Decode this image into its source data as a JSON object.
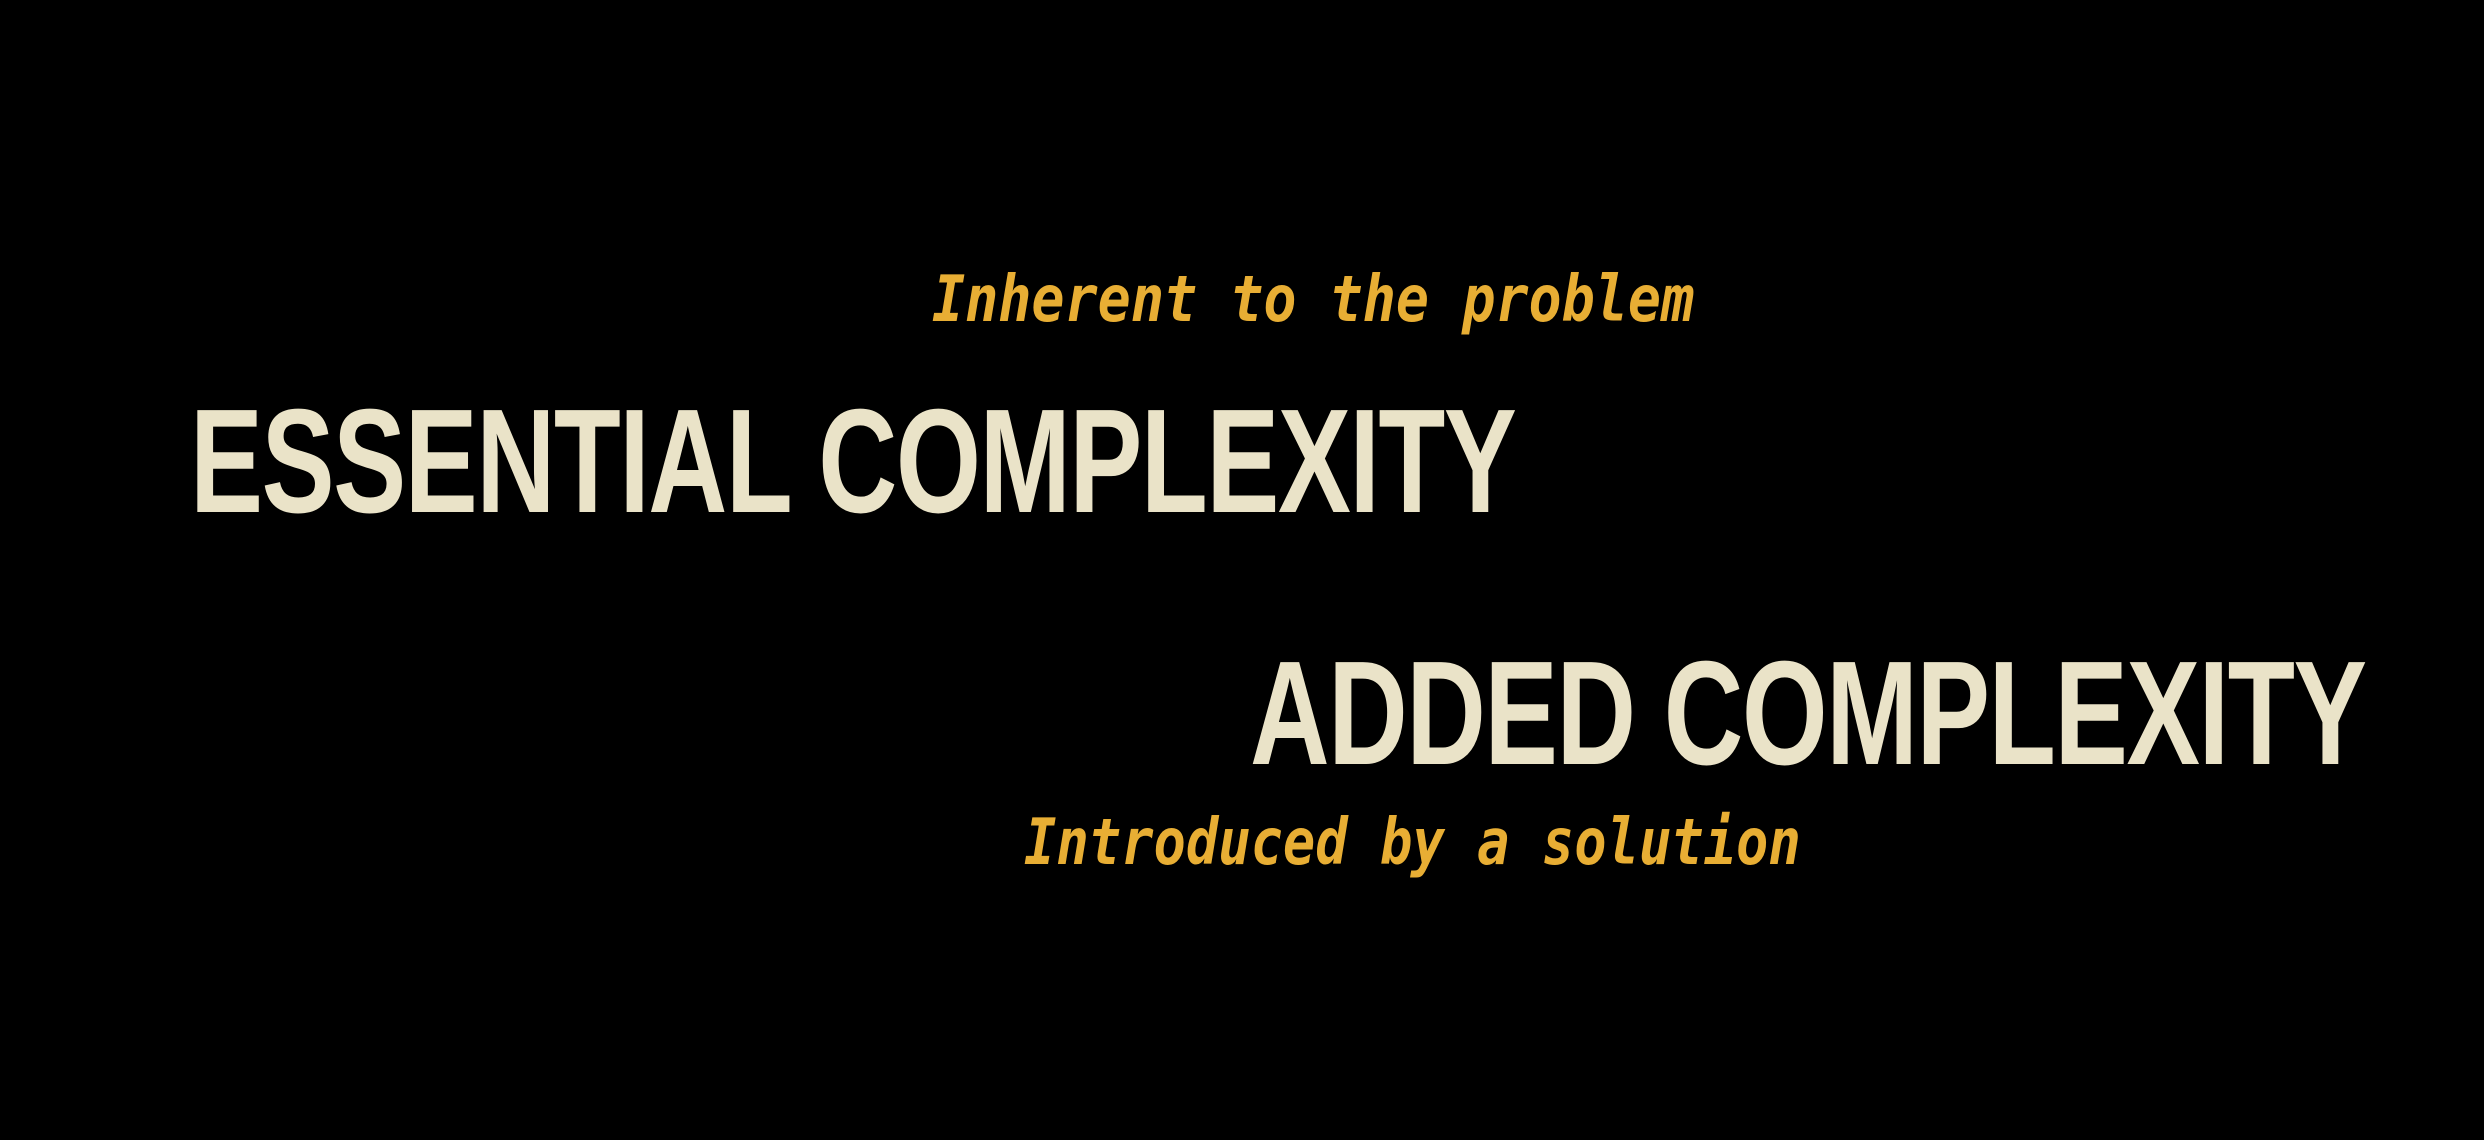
{
  "slide": {
    "background_color": "#000000",
    "text_color": "#EAE3C8",
    "annotation_color": "#E8AE34",
    "essential": {
      "annotation": "Inherent to the problem",
      "title": "ESSENTIAL COMPLEXITY"
    },
    "added": {
      "title": "ADDED COMPLEXITY",
      "annotation": "Introduced by a solution"
    }
  }
}
